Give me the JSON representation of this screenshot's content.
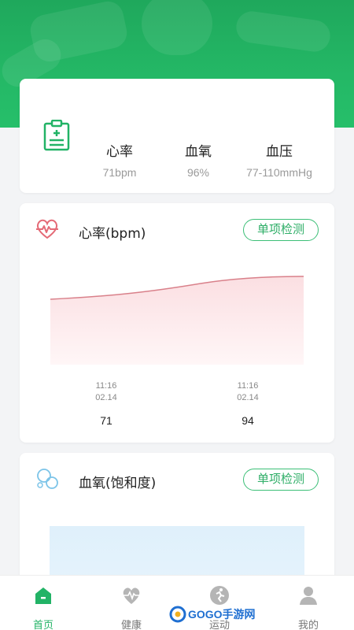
{
  "summary": {
    "metrics": [
      {
        "label": "心率",
        "value": "71bpm"
      },
      {
        "label": "血氧",
        "value": "96%"
      },
      {
        "label": "血压",
        "value": "77-110mmHg"
      }
    ]
  },
  "heart_rate": {
    "title": "心率(bpm)",
    "check_button": "单项检测",
    "points": [
      {
        "time": "11:16",
        "date": "02.14",
        "value": "71"
      },
      {
        "time": "11:16",
        "date": "02.14",
        "value": "94"
      }
    ],
    "line_color": "#e0787f",
    "fill_color": "#fde8ea"
  },
  "blood_oxygen": {
    "title": "血氧(饱和度)",
    "check_button": "单项检测"
  },
  "tabs": [
    {
      "label": "首页",
      "icon": "home-icon",
      "active": true
    },
    {
      "label": "健康",
      "icon": "heart-icon",
      "active": false
    },
    {
      "label": "运动",
      "icon": "runner-icon",
      "active": false
    },
    {
      "label": "我的",
      "icon": "user-icon",
      "active": false
    }
  ],
  "watermark": {
    "text": "GOGO手游网"
  },
  "colors": {
    "brand": "#22b366",
    "background": "#f3f4f6"
  }
}
